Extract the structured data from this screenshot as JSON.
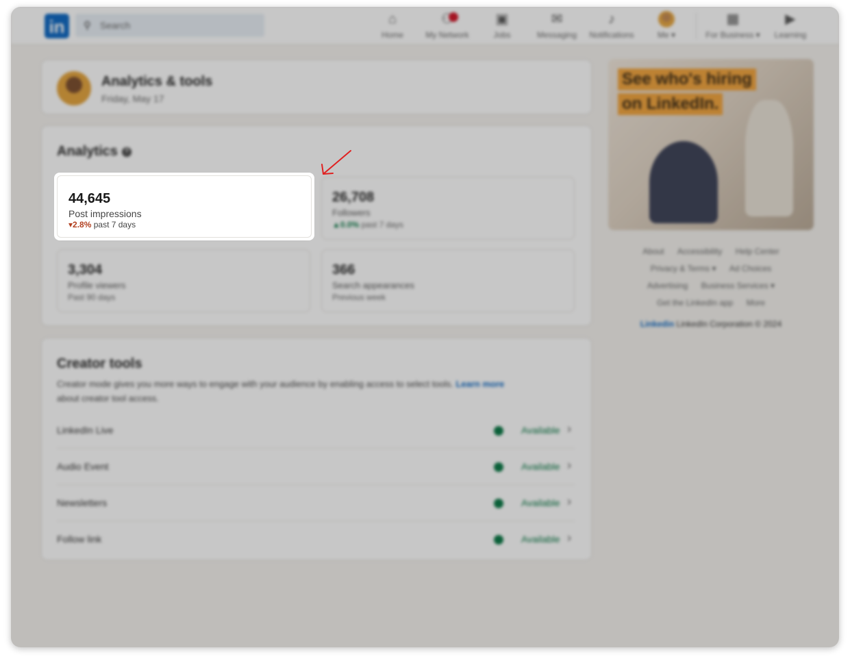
{
  "nav": {
    "logo": "in",
    "search_placeholder": "Search",
    "items": [
      {
        "label": "Home",
        "icon": "⌂"
      },
      {
        "label": "My Network",
        "icon": "⚇"
      },
      {
        "label": "Jobs",
        "icon": "▣"
      },
      {
        "label": "Messaging",
        "icon": "✉"
      },
      {
        "label": "Notifications",
        "icon": "♪"
      },
      {
        "label": "Me ▾",
        "icon": ""
      },
      {
        "label": "For Business ▾",
        "icon": "▦"
      },
      {
        "label": "Learning",
        "icon": "▶"
      }
    ]
  },
  "header": {
    "title": "Analytics & tools",
    "date": "Friday, May 17"
  },
  "analytics": {
    "title": "Analytics",
    "stats": [
      {
        "value": "44,645",
        "label": "Post impressions",
        "change": "2.8%",
        "period": "past 7 days"
      },
      {
        "value": "26,708",
        "label": "Followers",
        "change": "0.0%",
        "period": "past 7 days"
      },
      {
        "value": "3,304",
        "label": "Profile viewers",
        "period": "Past 90 days"
      },
      {
        "value": "366",
        "label": "Search appearances",
        "period": "Previous week"
      }
    ]
  },
  "creator": {
    "title": "Creator tools",
    "description": "Creator mode gives you more ways to engage with your audience by enabling access to select tools.",
    "learn_more": "Learn more",
    "description_tail": "about creator tool access.",
    "tools": [
      {
        "name": "LinkedIn Live",
        "status": "Available"
      },
      {
        "name": "Audio Event",
        "status": "Available"
      },
      {
        "name": "Newsletters",
        "status": "Available"
      },
      {
        "name": "Follow link",
        "status": "Available"
      }
    ]
  },
  "ad": {
    "line1": "See who's hiring",
    "line2": "on LinkedIn."
  },
  "footer": {
    "links": [
      "About",
      "Accessibility",
      "Help Center",
      "Privacy & Terms ▾",
      "Ad Choices",
      "Advertising",
      "Business Services ▾",
      "Get the LinkedIn app",
      "More"
    ],
    "brand": "Linkedin",
    "copyright": "LinkedIn Corporation © 2024"
  },
  "colors": {
    "brand": "#0a66c2",
    "positive": "#057642",
    "negative": "#b24020",
    "annotation_arrow": "#e02020"
  }
}
